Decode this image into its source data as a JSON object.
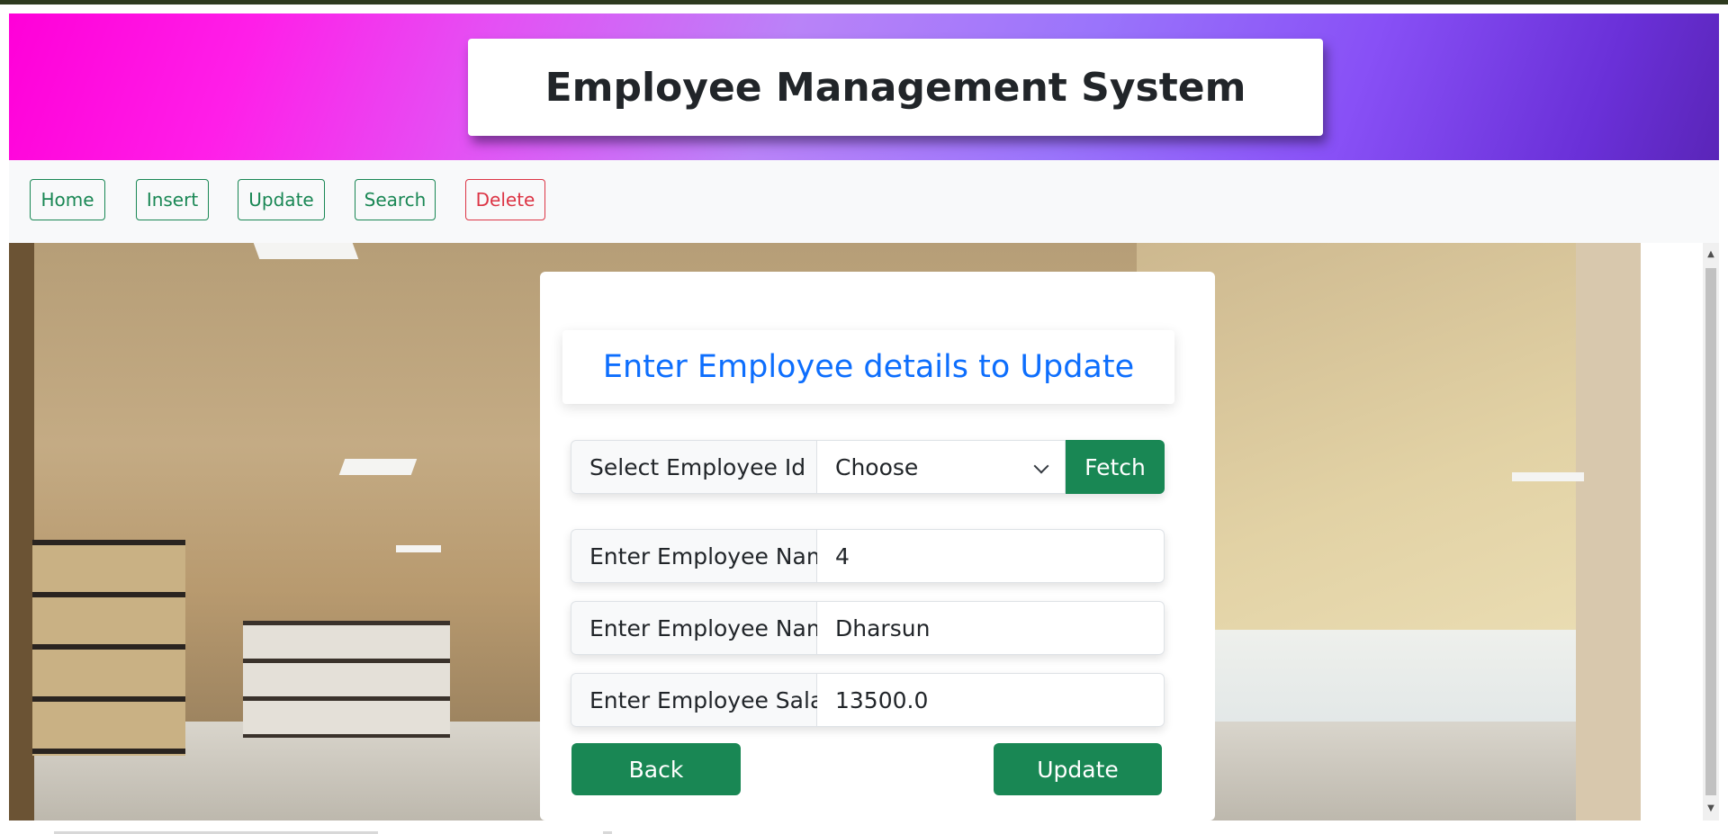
{
  "header": {
    "title": "Employee Management System"
  },
  "nav": {
    "home": "Home",
    "insert": "Insert",
    "update": "Update",
    "search": "Search",
    "delete": "Delete"
  },
  "form": {
    "heading": "Enter Employee details to Update",
    "select_label": "Select Employee Id",
    "select_value": "Choose",
    "fetch_label": "Fetch",
    "id_label": "Enter Employee Name",
    "id_value": "4",
    "name_label": "Enter Employee Name",
    "name_value": "Dharsun",
    "salary_label": "Enter Employee Salary",
    "salary_value": "13500.0",
    "back_label": "Back",
    "update_label": "Update"
  },
  "colors": {
    "success": "#198754",
    "danger": "#dc3545",
    "primary": "#0d6efd"
  },
  "icons": {
    "select_arrow": "chevron-down-icon"
  }
}
